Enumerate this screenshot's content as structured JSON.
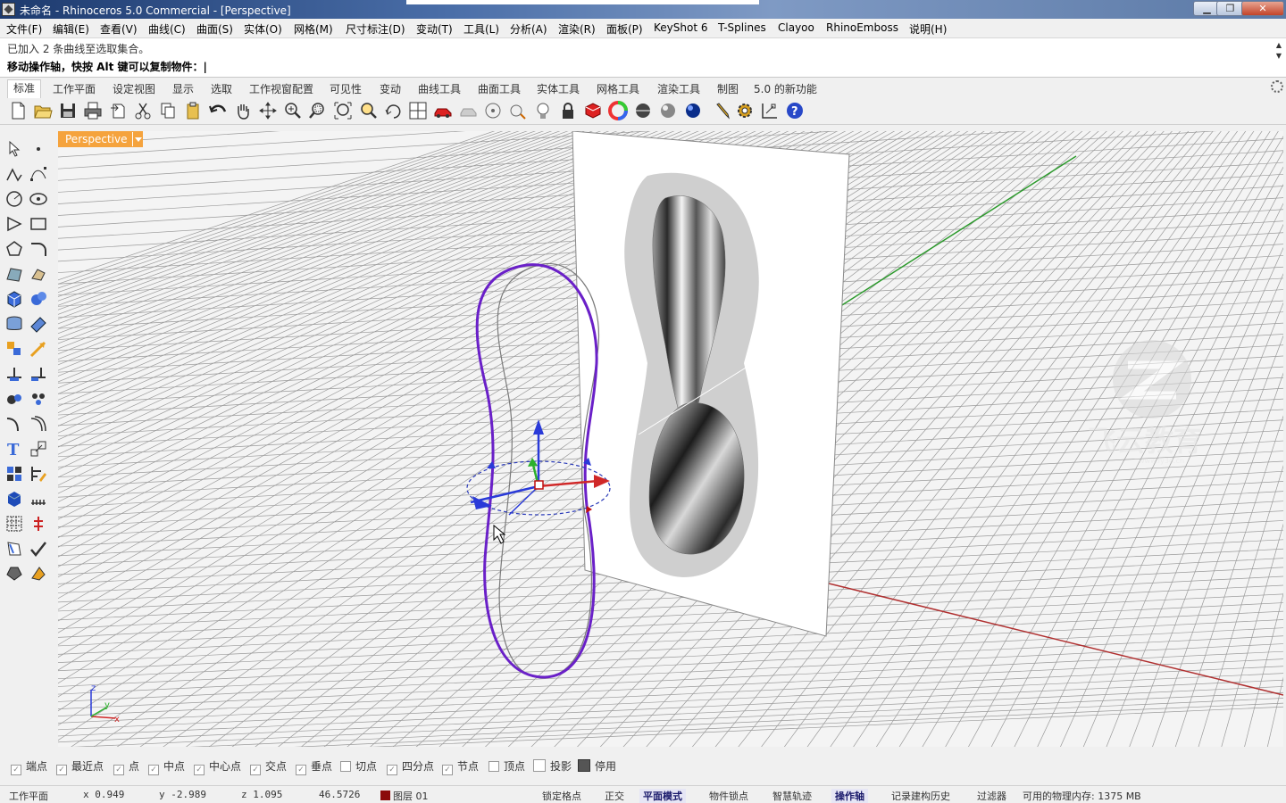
{
  "window": {
    "title": "未命名 - Rhinoceros 5.0 Commercial - [Perspective]",
    "minimize": "▁",
    "maximize": "❐",
    "close": "✕"
  },
  "menu": [
    "文件(F)",
    "编辑(E)",
    "查看(V)",
    "曲线(C)",
    "曲面(S)",
    "实体(O)",
    "网格(M)",
    "尺寸标注(D)",
    "变动(T)",
    "工具(L)",
    "分析(A)",
    "渲染(R)",
    "面板(P)",
    "KeyShot 6",
    "T-Splines",
    "Clayoo",
    "RhinoEmboss",
    "说明(H)"
  ],
  "command": {
    "history": "已加入 2 条曲线至选取集合。",
    "prompt": "移动操作轴，快按 Alt 键可以复制物件：|"
  },
  "tabs": [
    "标准",
    "工作平面",
    "设定视图",
    "显示",
    "选取",
    "工作视窗配置",
    "可见性",
    "变动",
    "曲线工具",
    "曲面工具",
    "实体工具",
    "网格工具",
    "渲染工具",
    "制图",
    "5.0 的新功能"
  ],
  "toolbar_icons": [
    "new-file-icon",
    "open-folder-icon",
    "save-icon",
    "print-icon",
    "import-icon",
    "cut-icon",
    "copy-icon",
    "paste-icon",
    "undo-icon",
    "pan-hand-icon",
    "rotate-view-icon",
    "zoom-window-icon",
    "zoom-dynamic-icon",
    "zoom-extents-icon",
    "zoom-selected-icon",
    "rotate-icon",
    "four-viewports-icon",
    "car-icon",
    "ghosted-icon",
    "circle-icon",
    "point-icon",
    "light-bulb-icon",
    "lock-icon",
    "material-icon",
    "color-wheel-icon",
    "sphere-icon",
    "sphere-shaded-icon",
    "sphere-blue-icon",
    "pencil-icon",
    "settings-gear-icon",
    "dimension-icon",
    "help-icon"
  ],
  "viewport": {
    "label": "Perspective"
  },
  "watermark": {
    "text": "飞云教育",
    "sub": "www.fy3d.cn"
  },
  "axis": {
    "x": "x",
    "y": "y",
    "z": "z"
  },
  "osnap": [
    {
      "label": "端点",
      "checked": true
    },
    {
      "label": "最近点",
      "checked": true
    },
    {
      "label": "点",
      "checked": true
    },
    {
      "label": "中点",
      "checked": true
    },
    {
      "label": "中心点",
      "checked": true
    },
    {
      "label": "交点",
      "checked": true
    },
    {
      "label": "垂点",
      "checked": true
    },
    {
      "label": "切点",
      "checked": false
    },
    {
      "label": "四分点",
      "checked": true
    },
    {
      "label": "节点",
      "checked": true
    },
    {
      "label": "顶点",
      "checked": false
    },
    {
      "label": "投影",
      "checked": false
    },
    {
      "label": "停用",
      "checked": true
    }
  ],
  "status": {
    "cplane": "工作平面",
    "x": "x 0.949",
    "y": "y -2.989",
    "z": "z 1.095",
    "dist": "46.5726",
    "layer": "图层 01",
    "layer_color": "#8b0a0a",
    "grid_snap": "锁定格点",
    "ortho": "正交",
    "planar": "平面模式",
    "osnap": "物件锁点",
    "smarttrack": "智慧轨迹",
    "gumball": "操作轴",
    "history": "记录建构历史",
    "filter": "过滤器",
    "memory": "可用的物理内存: 1375 MB"
  }
}
